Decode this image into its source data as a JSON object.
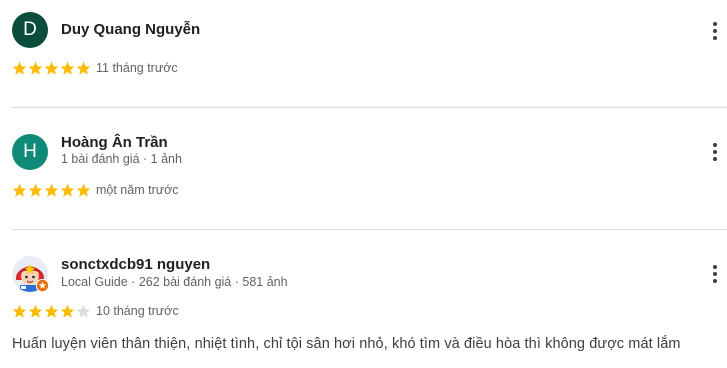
{
  "reviews": [
    {
      "avatar_letter": "D",
      "avatar_color": "#0b4d3a",
      "name": "Duy Quang Nguyễn",
      "meta": "",
      "rating": 5,
      "time": "11 tháng trước",
      "text": ""
    },
    {
      "avatar_letter": "H",
      "avatar_color": "#0f8a78",
      "name": "Hoàng Ân Trần",
      "meta": "1 bài đánh giá · 1 ảnh",
      "rating": 5,
      "time": "một năm trước",
      "text": ""
    },
    {
      "avatar_icon": "profile-photo-icon",
      "name": "sonctxdcb91 nguyen",
      "meta": "Local Guide · 262 bài đánh giá · 581 ảnh",
      "rating": 4,
      "time": "10 tháng trước",
      "text": "Huấn luyện viên thân thiện, nhiệt tình, chỉ tội sân hơi nhỏ, khó tìm và điều hòa thì không được mát lắm"
    }
  ],
  "icons": {
    "more": "more-vert-icon",
    "star": "star-icon",
    "local_guide": "local-guide-badge-icon"
  },
  "colors": {
    "star_filled": "#fbbc04",
    "star_empty": "#dadce0",
    "divider": "#dadce0",
    "local_guide_badge": "#e8710a"
  }
}
